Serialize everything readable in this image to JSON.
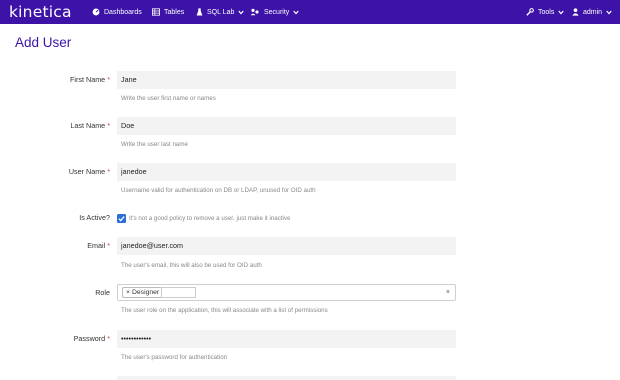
{
  "navbar": {
    "brand": "kinetica",
    "items": [
      {
        "label": "Dashboards",
        "icon": "dashboard-icon"
      },
      {
        "label": "Tables",
        "icon": "table-icon"
      },
      {
        "label": "SQL Lab",
        "icon": "flask-icon"
      },
      {
        "label": "Security",
        "icon": "users-icon"
      }
    ],
    "right": [
      {
        "label": "Tools",
        "icon": "wrench-icon"
      },
      {
        "label": "admin",
        "icon": "user-icon"
      }
    ],
    "background": "#3c13a6"
  },
  "page": {
    "title": "Add User"
  },
  "form": {
    "first_name": {
      "label": "First Name",
      "value": "Jane",
      "help": "Write the user first name or names"
    },
    "last_name": {
      "label": "Last Name",
      "value": "Doe",
      "help": "Write the user last name"
    },
    "username": {
      "label": "User Name",
      "value": "janedoe",
      "help": "Username valid for authentication on DB or LDAP, unused for OID auth"
    },
    "is_active": {
      "label": "Is Active?",
      "checked": true,
      "help": "It's not a good policy to remove a user, just make it inactive"
    },
    "email": {
      "label": "Email",
      "value": "janedoe@user.com",
      "help": "The user's email, this will also be used for OID auth"
    },
    "role": {
      "label": "Role",
      "selected": [
        "Designer"
      ],
      "clear": "×",
      "help": "The user role on the application, this will associate with a list of permissions"
    },
    "password": {
      "label": "Password",
      "value": "••••••••••••",
      "help": "The user's password for authentication"
    },
    "required_mark": "*"
  }
}
